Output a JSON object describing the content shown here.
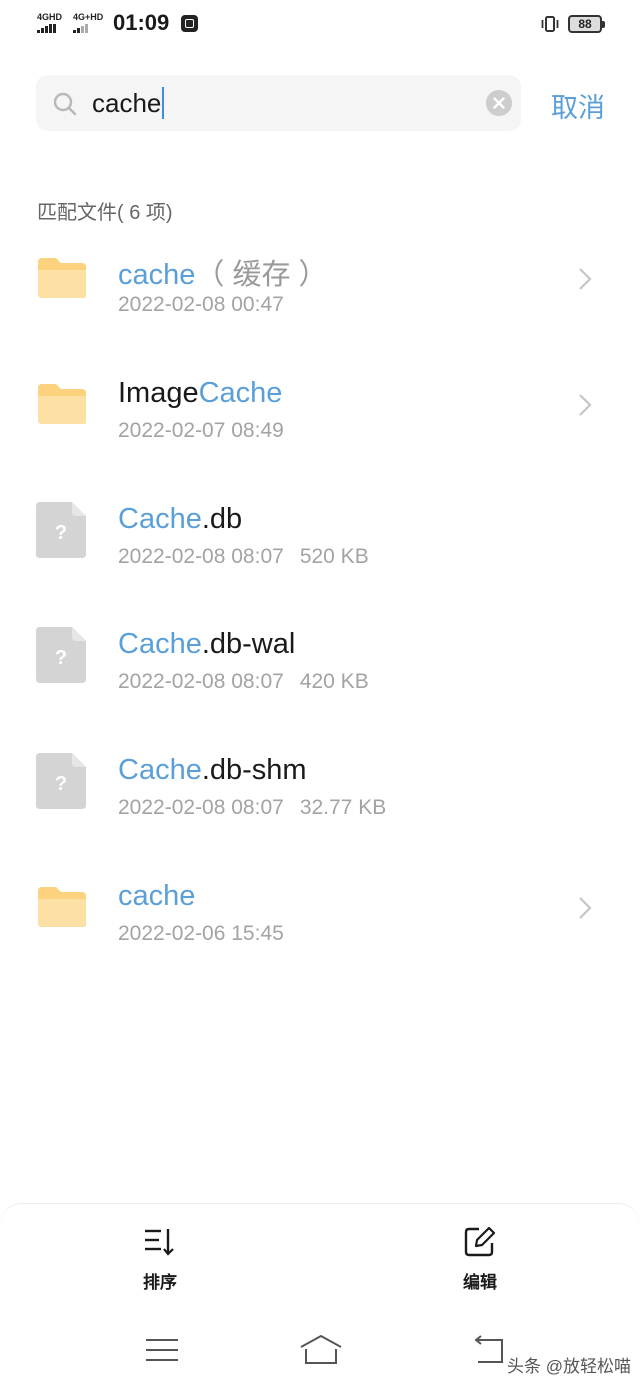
{
  "status_bar": {
    "sim1": "4GHD",
    "sim2": "4G+HD",
    "time": "01:09",
    "battery": "88",
    "icons": [
      "signal-icon",
      "app-notification-icon",
      "vibrate-icon",
      "battery-icon"
    ]
  },
  "search": {
    "query": "cache",
    "cancel_label": "取消",
    "icons": [
      "search-icon",
      "clear-icon"
    ]
  },
  "results": {
    "label": "匹配文件( 6 项)",
    "items": [
      {
        "type": "folder",
        "name_hl": "cache",
        "name_suffix": "",
        "name_note": "（ 缓存 ）",
        "date": "2022-02-08 00:47",
        "size": ""
      },
      {
        "type": "folder",
        "name_prefix": "Image",
        "name_hl": "Cache",
        "name_suffix": "",
        "date": "2022-02-07 08:49",
        "size": ""
      },
      {
        "type": "file",
        "name_hl": "Cache",
        "name_suffix": ".db",
        "date": "2022-02-08 08:07",
        "size": "520 KB"
      },
      {
        "type": "file",
        "name_hl": "Cache",
        "name_suffix": ".db-wal",
        "date": "2022-02-08 08:07",
        "size": "420 KB"
      },
      {
        "type": "file",
        "name_hl": "Cache",
        "name_suffix": ".db-shm",
        "date": "2022-02-08 08:07",
        "size": "32.77 KB"
      },
      {
        "type": "folder",
        "name_hl": "cache",
        "name_suffix": "",
        "date": "2022-02-06 15:45",
        "size": ""
      }
    ]
  },
  "bottom_actions": {
    "sort_label": "排序",
    "edit_label": "编辑"
  },
  "watermark": "头条 @放轻松喵",
  "colors": {
    "accent": "#5b9fd8",
    "folder": "#fcd27f",
    "file": "#d4d4d4"
  }
}
